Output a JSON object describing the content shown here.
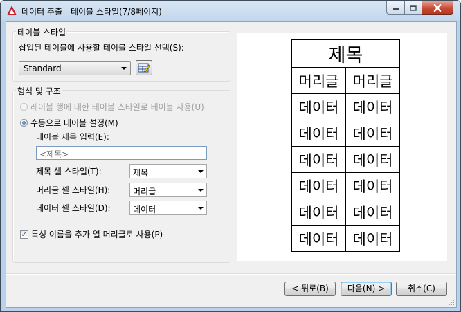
{
  "window": {
    "title": "데이터 추출 - 테이블 스타일(7/8페이지)"
  },
  "table_style_group": {
    "label": "테이블 스타일",
    "prompt": "삽입된 테이블에 사용할 테이블 스타일 선택(S):",
    "selected_style": "Standard"
  },
  "format_group": {
    "label": "형식 및 구조",
    "option_label_rows": "레이블 행에 대한 테이블 스타일로 테이블 사용(U)",
    "option_manual": "수동으로 테이블 설정(M)",
    "title_prompt": "테이블 제목 입력(E):",
    "title_placeholder": "<제목>",
    "title_cell_label": "제목 셀 스타일(T):",
    "title_cell_value": "제목",
    "header_cell_label": "머리글 셀 스타일(H):",
    "header_cell_value": "머리글",
    "data_cell_label": "데이터 셀 스타일(D):",
    "data_cell_value": "데이터",
    "use_property_names_label": "특성 이름을 추가 열 머리글로 사용(P)",
    "use_property_names_checked": true
  },
  "preview": {
    "title": "제목",
    "headers": [
      "머리글",
      "머리글"
    ],
    "rows": [
      [
        "데이터",
        "데이터"
      ],
      [
        "데이터",
        "데이터"
      ],
      [
        "데이터",
        "데이터"
      ],
      [
        "데이터",
        "데이터"
      ],
      [
        "데이터",
        "데이터"
      ],
      [
        "데이터",
        "데이터"
      ]
    ]
  },
  "buttons": {
    "back": "< 뒤로(B)",
    "next": "다음(N) >",
    "cancel": "취소(C)"
  },
  "colors": {
    "frame": "#b9d1ea",
    "client": "#f0f0f0",
    "close_button": "#c74a33"
  }
}
